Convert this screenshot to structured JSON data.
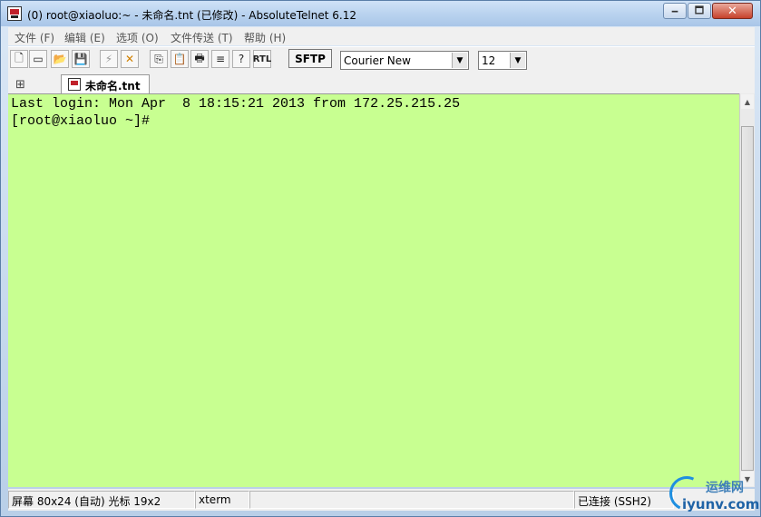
{
  "window": {
    "title": "(0) root@xiaoluo:~ - 未命名.tnt (已修改) - AbsoluteTelnet 6.12",
    "min_label": "🗕",
    "max_label": "🗖",
    "close_label": "✕"
  },
  "menu": [
    {
      "label": "文件 (F)"
    },
    {
      "label": "编辑 (E)"
    },
    {
      "label": "选项 (O)"
    },
    {
      "label": "文件传送 (T)"
    },
    {
      "label": "帮助 (H)"
    }
  ],
  "toolbar": {
    "icons": [
      "new-file-icon",
      "new-window-icon",
      "open-folder-icon",
      "save-icon",
      "connect-icon",
      "disconnect-icon",
      "copy-icon",
      "paste-icon",
      "print-icon",
      "log-icon",
      "help-icon",
      "rtl-icon"
    ],
    "sftp_label": "SFTP",
    "font_value": "Courier New",
    "size_value": "12"
  },
  "tabs": [
    {
      "label": "未命名.tnt"
    }
  ],
  "terminal": {
    "background": "#c8ff91",
    "lines": [
      "Last login: Mon Apr  8 18:15:21 2013 from 172.25.215.25",
      "[root@xiaoluo ~]#"
    ]
  },
  "status": {
    "screen": "屏幕 80x24 (自动) 光标 19x2",
    "term_type": "xterm",
    "empty": "",
    "connection": "已连接 (SSH2)"
  },
  "watermark": {
    "top": "运维网",
    "bottom": "iyunv.com"
  }
}
